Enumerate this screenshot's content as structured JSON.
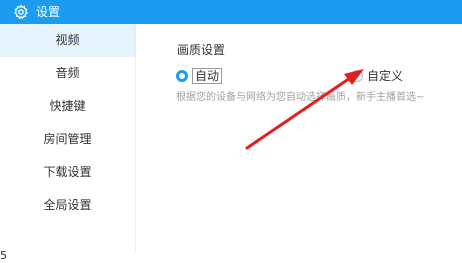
{
  "window": {
    "title": "设置",
    "icon": "gear-icon"
  },
  "sidebar": {
    "items": [
      {
        "label": "视频",
        "active": true
      },
      {
        "label": "音频",
        "active": false
      },
      {
        "label": "快捷键",
        "active": false
      },
      {
        "label": "房间管理",
        "active": false
      },
      {
        "label": "下载设置",
        "active": false
      },
      {
        "label": "全局设置",
        "active": false
      }
    ],
    "edge_glyph": "5"
  },
  "content": {
    "section_label": "画质设置",
    "options": [
      {
        "label": "自动",
        "selected": true
      },
      {
        "label": "自定义",
        "selected": false
      }
    ],
    "hint": "根据您的设备与网络为您自动选择画质，新手主播首选~"
  },
  "colors": {
    "accent": "#1c9cf0",
    "active_bg": "#e5f3fd",
    "annotation_arrow": "#e02020"
  }
}
